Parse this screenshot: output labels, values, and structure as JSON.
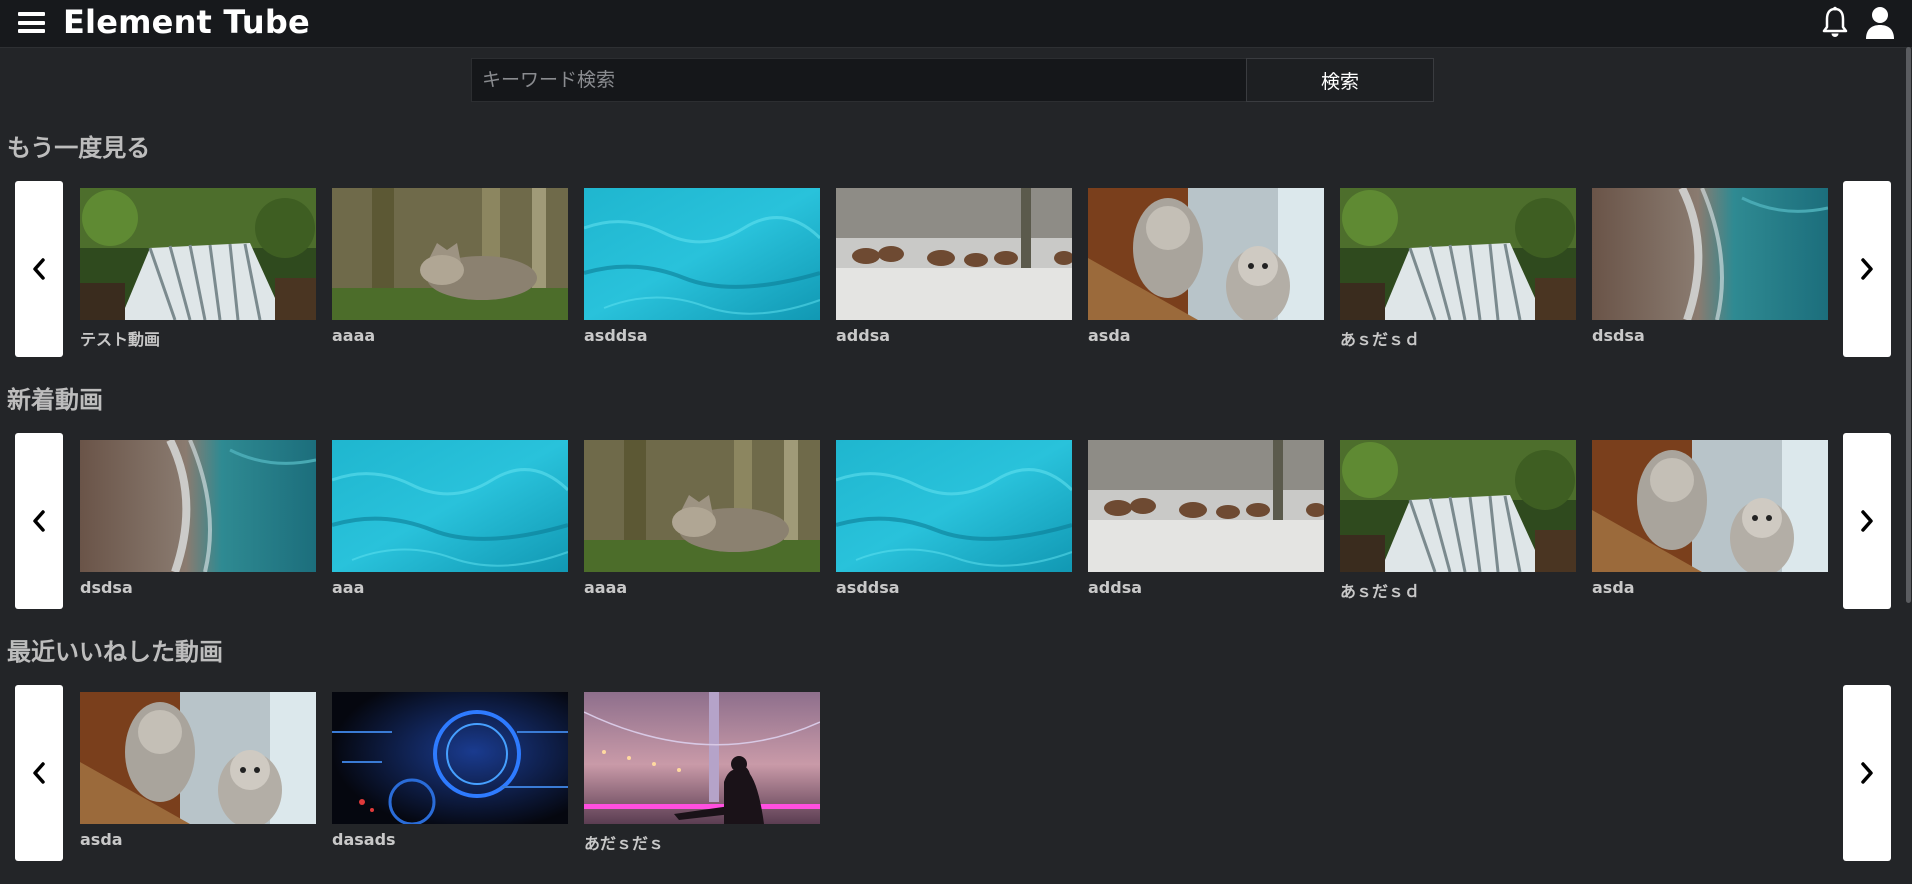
{
  "header": {
    "title": "Element Tube",
    "menu_icon": "hamburger-menu-icon",
    "notification_icon": "bell-icon",
    "account_icon": "user-icon"
  },
  "search": {
    "value": "",
    "placeholder": "キーワード検索",
    "button_label": "検索"
  },
  "sections": [
    {
      "title": "もう一度見る",
      "videos": [
        {
          "title": "テスト動画",
          "thumb": "waterfall"
        },
        {
          "title": "aaaa",
          "thumb": "wolf"
        },
        {
          "title": "asddsa",
          "thumb": "water"
        },
        {
          "title": "addsa",
          "thumb": "deer"
        },
        {
          "title": "asda",
          "thumb": "owl"
        },
        {
          "title": "あｓだｓｄ",
          "thumb": "waterfall"
        },
        {
          "title": "dsdsa",
          "thumb": "shore"
        }
      ]
    },
    {
      "title": "新着動画",
      "videos": [
        {
          "title": "dsdsa",
          "thumb": "shore"
        },
        {
          "title": "aaa",
          "thumb": "water"
        },
        {
          "title": "aaaa",
          "thumb": "wolf"
        },
        {
          "title": "asddsa",
          "thumb": "water"
        },
        {
          "title": "addsa",
          "thumb": "deer"
        },
        {
          "title": "あｓだｓｄ",
          "thumb": "waterfall"
        },
        {
          "title": "asda",
          "thumb": "owl"
        }
      ]
    },
    {
      "title": "最近いいねした動画",
      "videos": [
        {
          "title": "asda",
          "thumb": "owl"
        },
        {
          "title": "dasads",
          "thumb": "tech"
        },
        {
          "title": "あだｓだｓ",
          "thumb": "bridge"
        }
      ]
    }
  ],
  "icons": {
    "prev": "chevron-left-icon",
    "next": "chevron-right-icon"
  },
  "colors": {
    "background": "#232528",
    "header": "#17191c",
    "accent_white": "#ffffff"
  }
}
